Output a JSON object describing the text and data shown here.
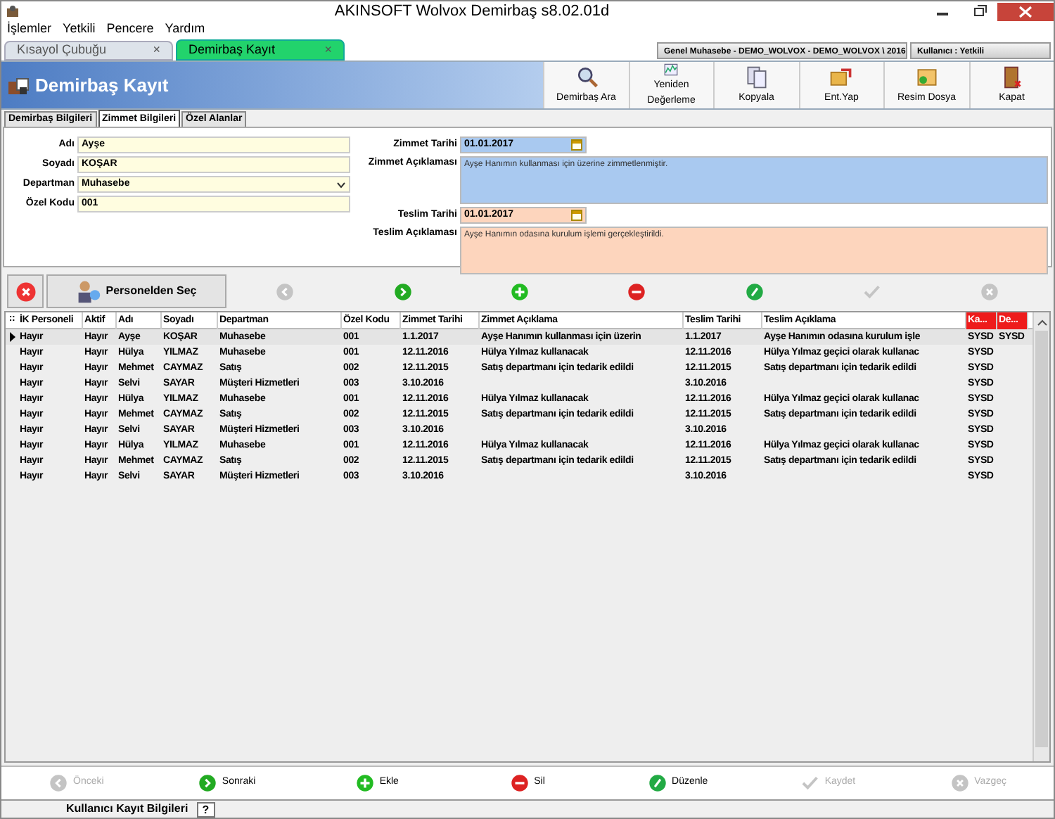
{
  "window": {
    "title": "AKINSOFT Wolvox Demirbaş s8.02.01d"
  },
  "menu": [
    "İşlemler",
    "Yetkili",
    "Pencere",
    "Yardım"
  ],
  "tabs": [
    {
      "label": "Kısayol Çubuğu",
      "close": "×",
      "selected": false
    },
    {
      "label": "Demirbaş Kayıt",
      "close": "×",
      "selected": true
    }
  ],
  "info_panels": [
    "Genel Muhasebe - DEMO_WOLVOX - DEMO_WOLVOX \\ 2016",
    "Kullanıcı : Yetkili"
  ],
  "header": {
    "title": "Demirbaş Kayıt"
  },
  "toolbar": [
    {
      "kind": "search",
      "label": "Demirbaş Ara"
    },
    {
      "kind": "chart",
      "label": "Yeniden Değerleme"
    },
    {
      "kind": "copy",
      "label": "Kopyala"
    },
    {
      "kind": "transfer",
      "label": "Ent.Yap"
    },
    {
      "kind": "image",
      "label": "Resim Dosya"
    },
    {
      "kind": "exit",
      "label": "Kapat"
    }
  ],
  "sub_tabs": [
    {
      "label": "Demirbaş Bilgileri",
      "selected": false
    },
    {
      "label": "Zimmet Bilgileri",
      "selected": true
    },
    {
      "label": "Özel Alanlar",
      "selected": false
    }
  ],
  "left_fields": [
    {
      "label": "Adı",
      "value": "Ayşe",
      "kind": "text"
    },
    {
      "label": "Soyadı",
      "value": "KOŞAR",
      "kind": "text"
    },
    {
      "label": "Departman",
      "value": "Muhasebe",
      "kind": "select"
    },
    {
      "label": "Özel Kodu",
      "value": "001",
      "kind": "text"
    }
  ],
  "right_fields": [
    {
      "label": "Zimmet Tarihi",
      "value": "01.01.2017",
      "kind": "date",
      "color": "#a9c9f0"
    },
    {
      "label": "Zimmet Açıklaması",
      "value": "Ayşe Hanımın kullanması için üzerine zimmetlenmiştir.",
      "kind": "memo",
      "color": "#a9c9f0"
    },
    {
      "label": "Teslim Tarihi",
      "value": "01.01.2017",
      "kind": "date",
      "color": "#fdd5bd"
    },
    {
      "label": "Teslim Açıklaması",
      "value": "Ayşe Hanımın odasına kurulum işlemi gerçekleştirildi.",
      "kind": "memo",
      "color": "#fdd5bd"
    }
  ],
  "detail_actions": [
    {
      "kind": "cancel",
      "disabled": false
    },
    {
      "kind": "pick",
      "label": "Personelden Seç",
      "disabled": false
    },
    {
      "kind": "prev",
      "disabled": true
    },
    {
      "kind": "next",
      "disabled": false
    },
    {
      "kind": "add",
      "disabled": false
    },
    {
      "kind": "delete",
      "disabled": false
    },
    {
      "kind": "edit",
      "disabled": false
    },
    {
      "kind": "save",
      "disabled": true
    },
    {
      "kind": "discard",
      "disabled": true
    }
  ],
  "table": {
    "grip": "::",
    "columns": [
      "İK Personeli",
      "Aktif",
      "Adı",
      "Soyadı",
      "Departman",
      "Özel Kodu",
      "Zimmet Tarihi",
      "Zimmet Açıklama",
      "Teslim Tarihi",
      "Teslim Açıklama",
      "Ka...",
      "De..."
    ],
    "rows": [
      {
        "selected": true,
        "cells": [
          "Hayır",
          "Hayır",
          "Ayşe",
          "KOŞAR",
          "Muhasebe",
          "001",
          "1.1.2017",
          "Ayşe Hanımın kullanması için üzerin",
          "1.1.2017",
          "Ayşe Hanımın odasına kurulum işle",
          "SYSD",
          "SYSD"
        ]
      },
      {
        "selected": false,
        "cells": [
          "Hayır",
          "Hayır",
          "Hülya",
          "YILMAZ",
          "Muhasebe",
          "001",
          "12.11.2016",
          "Hülya Yılmaz kullanacak",
          "12.11.2016",
          "Hülya Yılmaz geçici olarak kullanac",
          "SYSD",
          ""
        ]
      },
      {
        "selected": false,
        "cells": [
          "Hayır",
          "Hayır",
          "Mehmet",
          "CAYMAZ",
          "Satış",
          "002",
          "12.11.2015",
          "Satış departmanı için tedarik edildi",
          "12.11.2015",
          "Satış departmanı için tedarik edildi",
          "SYSD",
          ""
        ]
      },
      {
        "selected": false,
        "cells": [
          "Hayır",
          "Hayır",
          "Selvi",
          "SAYAR",
          "Müşteri Hizmetleri",
          "003",
          "3.10.2016",
          "",
          "3.10.2016",
          "",
          "SYSD",
          ""
        ]
      },
      {
        "selected": false,
        "cells": [
          "Hayır",
          "Hayır",
          "Hülya",
          "YILMAZ",
          "Muhasebe",
          "001",
          "12.11.2016",
          "Hülya Yılmaz kullanacak",
          "12.11.2016",
          "Hülya Yılmaz geçici olarak kullanac",
          "SYSD",
          ""
        ]
      },
      {
        "selected": false,
        "cells": [
          "Hayır",
          "Hayır",
          "Mehmet",
          "CAYMAZ",
          "Satış",
          "002",
          "12.11.2015",
          "Satış departmanı için tedarik edildi",
          "12.11.2015",
          "Satış departmanı için tedarik edildi",
          "SYSD",
          ""
        ]
      },
      {
        "selected": false,
        "cells": [
          "Hayır",
          "Hayır",
          "Selvi",
          "SAYAR",
          "Müşteri Hizmetleri",
          "003",
          "3.10.2016",
          "",
          "3.10.2016",
          "",
          "SYSD",
          ""
        ]
      },
      {
        "selected": false,
        "cells": [
          "Hayır",
          "Hayır",
          "Hülya",
          "YILMAZ",
          "Muhasebe",
          "001",
          "12.11.2016",
          "Hülya Yılmaz kullanacak",
          "12.11.2016",
          "Hülya Yılmaz geçici olarak kullanac",
          "SYSD",
          ""
        ]
      },
      {
        "selected": false,
        "cells": [
          "Hayır",
          "Hayır",
          "Mehmet",
          "CAYMAZ",
          "Satış",
          "002",
          "12.11.2015",
          "Satış departmanı için tedarik edildi",
          "12.11.2015",
          "Satış departmanı için tedarik edildi",
          "SYSD",
          ""
        ]
      },
      {
        "selected": false,
        "cells": [
          "Hayır",
          "Hayır",
          "Selvi",
          "SAYAR",
          "Müşteri Hizmetleri",
          "003",
          "3.10.2016",
          "",
          "3.10.2016",
          "",
          "SYSD",
          ""
        ]
      }
    ]
  },
  "navigation": [
    {
      "kind": "prev",
      "label": "Önceki",
      "disabled": true
    },
    {
      "kind": "next",
      "label": "Sonraki",
      "disabled": false
    },
    {
      "kind": "add",
      "label": "Ekle",
      "disabled": false
    },
    {
      "kind": "delete",
      "label": "Sil",
      "disabled": false
    },
    {
      "kind": "edit",
      "label": "Düzenle",
      "disabled": false
    },
    {
      "kind": "save",
      "label": "Kaydet",
      "disabled": true
    },
    {
      "kind": "discard",
      "label": "Vazgeç",
      "disabled": true
    }
  ],
  "status_bar": {
    "label": "Kullanıcı Kayıt Bilgileri",
    "help": "?"
  }
}
